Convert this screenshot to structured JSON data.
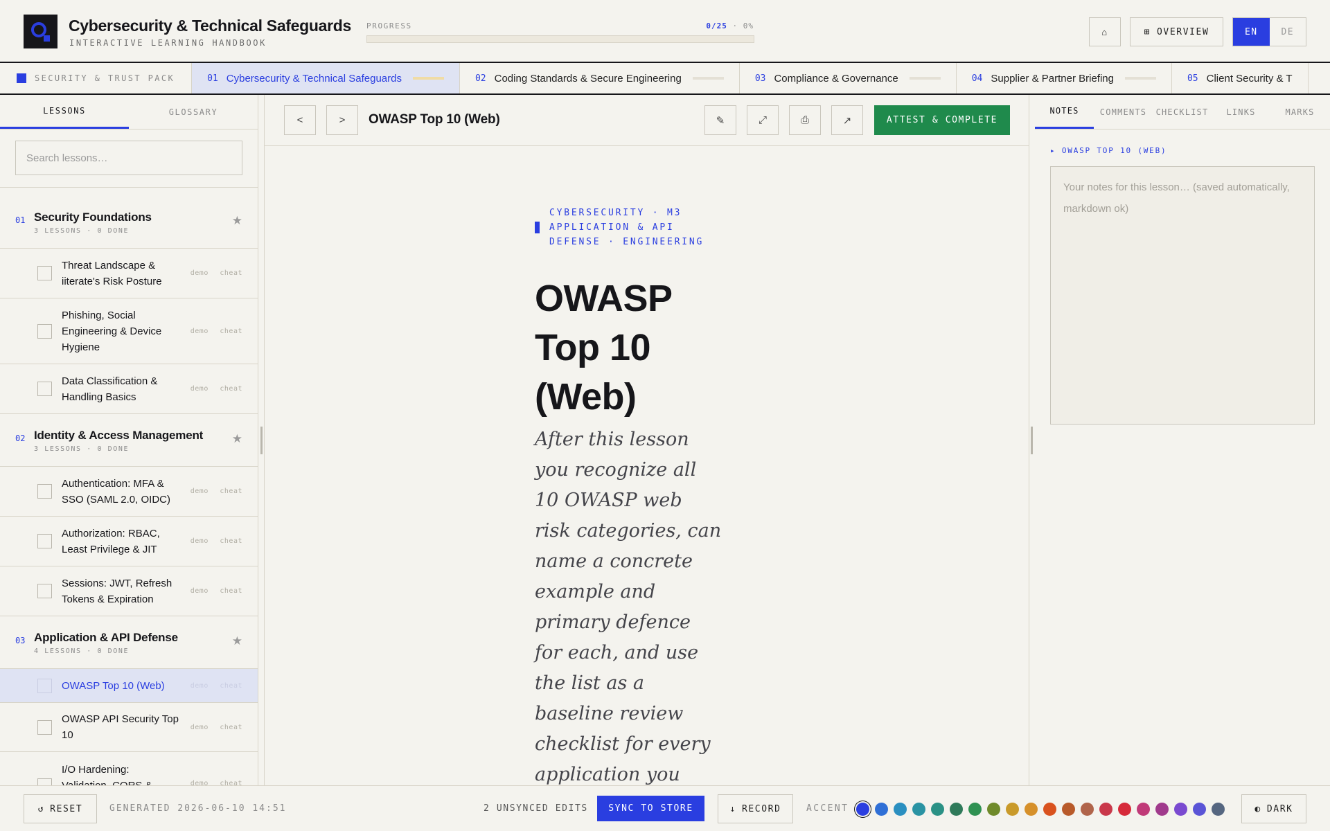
{
  "header": {
    "title": "Cybersecurity & Technical Safeguards",
    "subtitle": "INTERACTIVE LEARNING HANDBOOK",
    "progress_label": "PROGRESS",
    "progress_done": "0/25",
    "progress_percent_text": "· 0%",
    "progress_fraction": 0,
    "home_icon": "⌂",
    "overview_icon": "⊞",
    "overview_label": "OVERVIEW",
    "lang_en": "EN",
    "lang_de": "DE"
  },
  "tabs": {
    "pack_label": "SECURITY & TRUST PACK",
    "items": [
      {
        "num": "01",
        "label": "Cybersecurity & Technical Safeguards"
      },
      {
        "num": "02",
        "label": "Coding Standards & Secure Engineering"
      },
      {
        "num": "03",
        "label": "Compliance & Governance"
      },
      {
        "num": "04",
        "label": "Supplier & Partner Briefing"
      },
      {
        "num": "05",
        "label": "Client Security & T"
      }
    ]
  },
  "sidebar": {
    "tab_lessons": "LESSONS",
    "tab_glossary": "GLOSSARY",
    "search_placeholder": "Search lessons…",
    "tag_demo": "demo",
    "tag_cheat": "cheat",
    "star": "★",
    "modules": [
      {
        "num": "01",
        "title": "Security Foundations",
        "meta": "3 LESSONS · 0 DONE",
        "lessons": [
          "Threat Landscape & iiterate's Risk Posture",
          "Phishing, Social Engineering & Device Hygiene",
          "Data Classification & Handling Basics"
        ]
      },
      {
        "num": "02",
        "title": "Identity & Access Management",
        "meta": "3 LESSONS · 0 DONE",
        "lessons": [
          "Authentication: MFA & SSO (SAML 2.0, OIDC)",
          "Authorization: RBAC, Least Privilege & JIT",
          "Sessions: JWT, Refresh Tokens & Expiration"
        ]
      },
      {
        "num": "03",
        "title": "Application & API Defense",
        "meta": "4 LESSONS · 0 DONE",
        "lessons": [
          "OWASP Top 10 (Web)",
          "OWASP API Security Top 10",
          "I/O Hardening: Validation, CORS &"
        ]
      }
    ]
  },
  "toolbar": {
    "prev": "<",
    "next": ">",
    "lesson_title": "OWASP Top 10 (Web)",
    "edit_icon": "✎",
    "expand_icon": "⤢",
    "print_icon": "⎙",
    "open_icon": "↗",
    "attest_label": "ATTEST & COMPLETE"
  },
  "lesson": {
    "kicker": "CYBERSECURITY · M3 APPLICATION & API DEFENSE · ENGINEERING",
    "title": "OWASP Top 10 (Web)",
    "lead": "After this lesson you recognize all 10 OWASP web risk categories, can name a concrete example and primary defence for each, and use the list as a baseline review checklist for every application you"
  },
  "rightpanel": {
    "tabs": [
      "NOTES",
      "COMMENTS",
      "CHECKLIST",
      "LINKS",
      "MARKS"
    ],
    "notes_for": "▸ OWASP TOP 10 (WEB)",
    "notes_placeholder": "Your notes for this lesson… (saved automatically, markdown ok)"
  },
  "footer": {
    "reset_icon": "↺",
    "reset_label": "RESET",
    "generated": "GENERATED 2026-06-10 14:51",
    "unsynced": "2 UNSYNCED EDITS",
    "sync_label": "SYNC TO STORE",
    "record_icon": "↓",
    "record_label": "RECORD",
    "accent_label": "ACCENT",
    "accent_colors": [
      "#2a3ee0",
      "#2f6fd6",
      "#2a8fc0",
      "#2a93a3",
      "#2a9185",
      "#2f7a5a",
      "#2f9152",
      "#6f8a2a",
      "#c99a2a",
      "#d6902a",
      "#d9521e",
      "#b85a2a",
      "#b0644a",
      "#c9384a",
      "#d62a3a",
      "#c03a78",
      "#a03a8c",
      "#7a4ad0",
      "#5a54d6",
      "#556680"
    ],
    "dark_icon": "◐",
    "dark_label": "DARK"
  }
}
